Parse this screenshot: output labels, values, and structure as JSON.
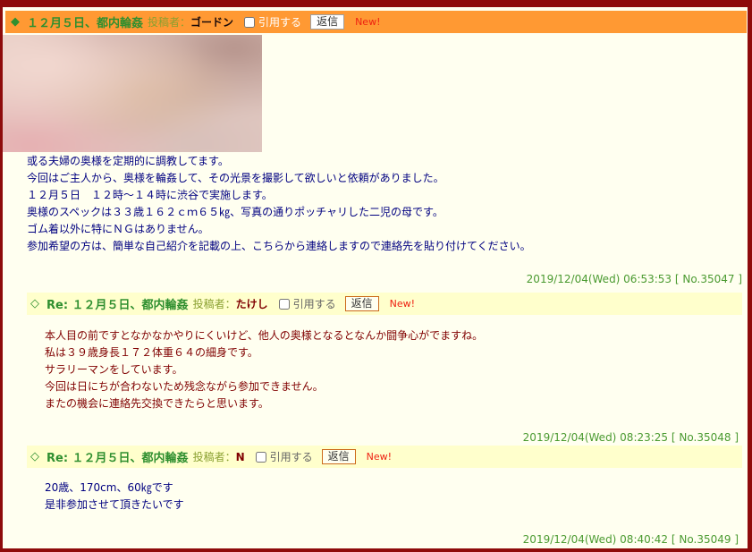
{
  "colors": {
    "frame": "#8e0b0b",
    "panel_bg": "#fffff0",
    "header_bg": "#ff9933",
    "reply_header_bg": "#ffffcc",
    "title": "#2f8f2f",
    "author_label": "#8aa030",
    "date": "#4a9a30",
    "new_badge": "#ee2211"
  },
  "posts": [
    {
      "marker": "◆",
      "title": "１２月５日、都内輪姦",
      "author_label": "投稿者：",
      "author": "ゴードン",
      "quote_label": "引用する",
      "reply_label": "返信",
      "new_badge": "New!",
      "text_color": "#000080",
      "body": [
        "或る夫婦の奥様を定期的に調教してます。",
        "今回はご主人から、奥様を輪姦して、その光景を撮影して欲しいと依頼がありました。",
        "１２月５日　１２時～１４時に渋谷で実施します。",
        "奥様のスペックは３３歳１６２ｃｍ６５㎏、写真の通りポッチャリした二児の母です。",
        "ゴム着以外に特にＮＧはありません。",
        "参加希望の方は、簡単な自己紹介を記載の上、こちらから連絡しますので連絡先を貼り付けてください。"
      ],
      "date": "2019/12/04(Wed) 06:53:53",
      "number": "[ No.35047 ]"
    },
    {
      "marker": "◇",
      "title": "Re: １２月５日、都内輪姦",
      "author_label": "投稿者：",
      "author": "たけし",
      "quote_label": "引用する",
      "reply_label": "返信",
      "new_badge": "New!",
      "text_color": "#800000",
      "body": [
        "本人目の前ですとなかなかやりにくいけど、他人の奥様となるとなんか闘争心がでますね。",
        "私は３９歳身長１７２体重６４の細身です。",
        "サラリーマンをしています。",
        "今回は日にちが合わないため残念ながら参加できません。",
        "またの機会に連絡先交換できたらと思います。"
      ],
      "date": "2019/12/04(Wed) 08:23:25",
      "number": "[ No.35048 ]"
    },
    {
      "marker": "◇",
      "title": "Re: １２月５日、都内輪姦",
      "author_label": "投稿者：",
      "author": "N",
      "quote_label": "引用する",
      "reply_label": "返信",
      "new_badge": "New!",
      "text_color": "#000080",
      "body": [
        "20歳、170cm、60㎏です",
        "是非参加させて頂きたいです"
      ],
      "date": "2019/12/04(Wed) 08:40:42",
      "number": "[ No.35049 ]"
    }
  ]
}
